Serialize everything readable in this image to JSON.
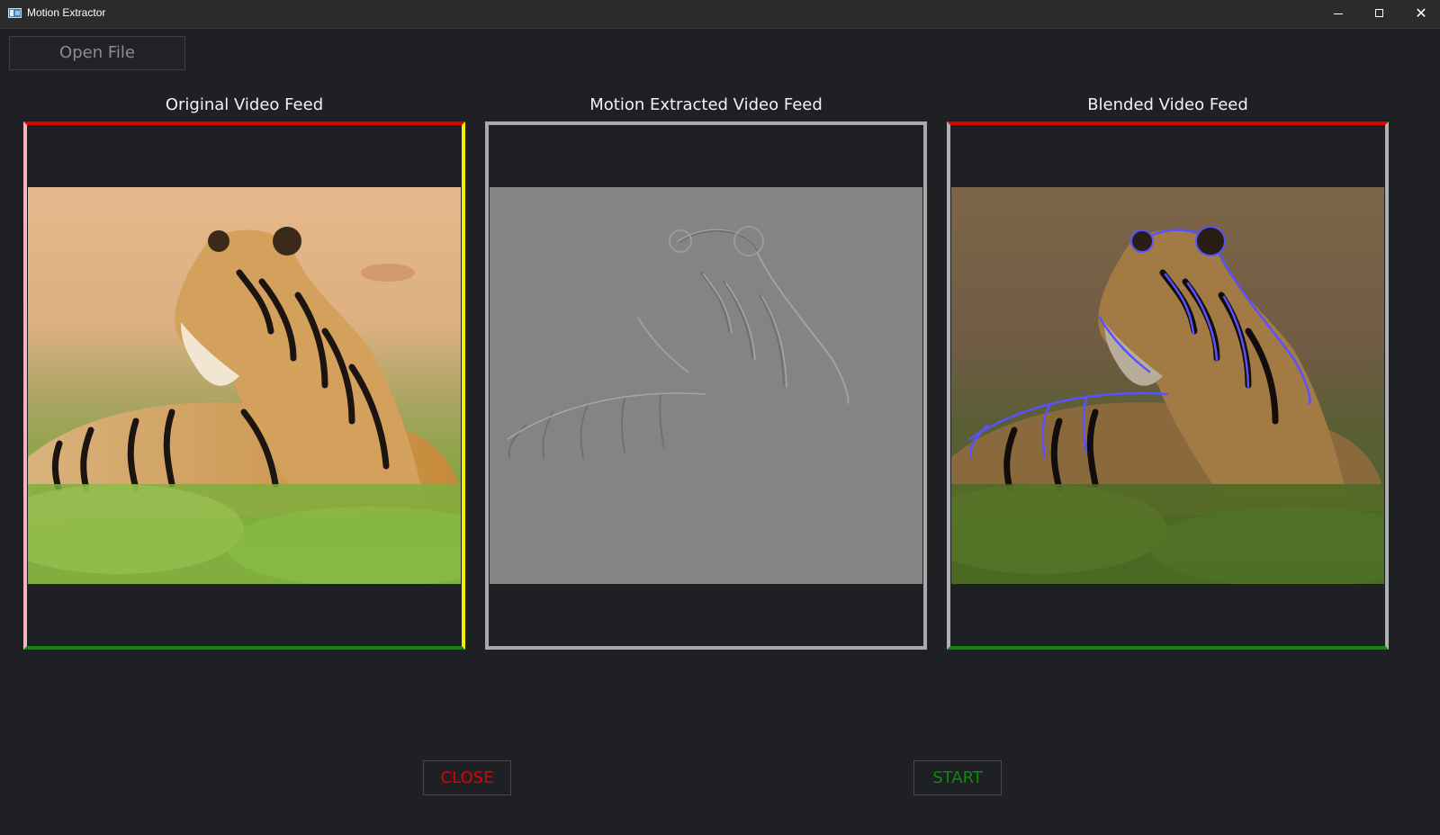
{
  "window": {
    "title": "Motion Extractor",
    "controls": [
      "minimize",
      "maximize",
      "close"
    ]
  },
  "toolbar": {
    "open_file_label": "Open File"
  },
  "feeds": [
    {
      "label": "Original Video Feed",
      "content": "tiger-photo",
      "border_colors": {
        "top": "#e00000",
        "left": "#f4b6bb",
        "right": "#f2f000",
        "bottom": "#0a8a12"
      }
    },
    {
      "label": "Motion Extracted Video Feed",
      "content": "tiger-embossed-gray",
      "border_colors": {
        "top": "#a9a9a9",
        "left": "#a9a9a9",
        "right": "#a9a9a9",
        "bottom": "#a9a9a9"
      }
    },
    {
      "label": "Blended Video Feed",
      "content": "tiger-blended",
      "border_colors": {
        "top": "#e00000",
        "left": "#b0b0b0",
        "right": "#b0b0b0",
        "bottom": "#0a8a12"
      }
    }
  ],
  "actions": {
    "close_label": "CLOSE",
    "start_label": "START",
    "close_color": "#e00000",
    "start_color": "#0a8a12"
  },
  "icons": {
    "app": "app-window-icon",
    "window_close": "✕"
  }
}
